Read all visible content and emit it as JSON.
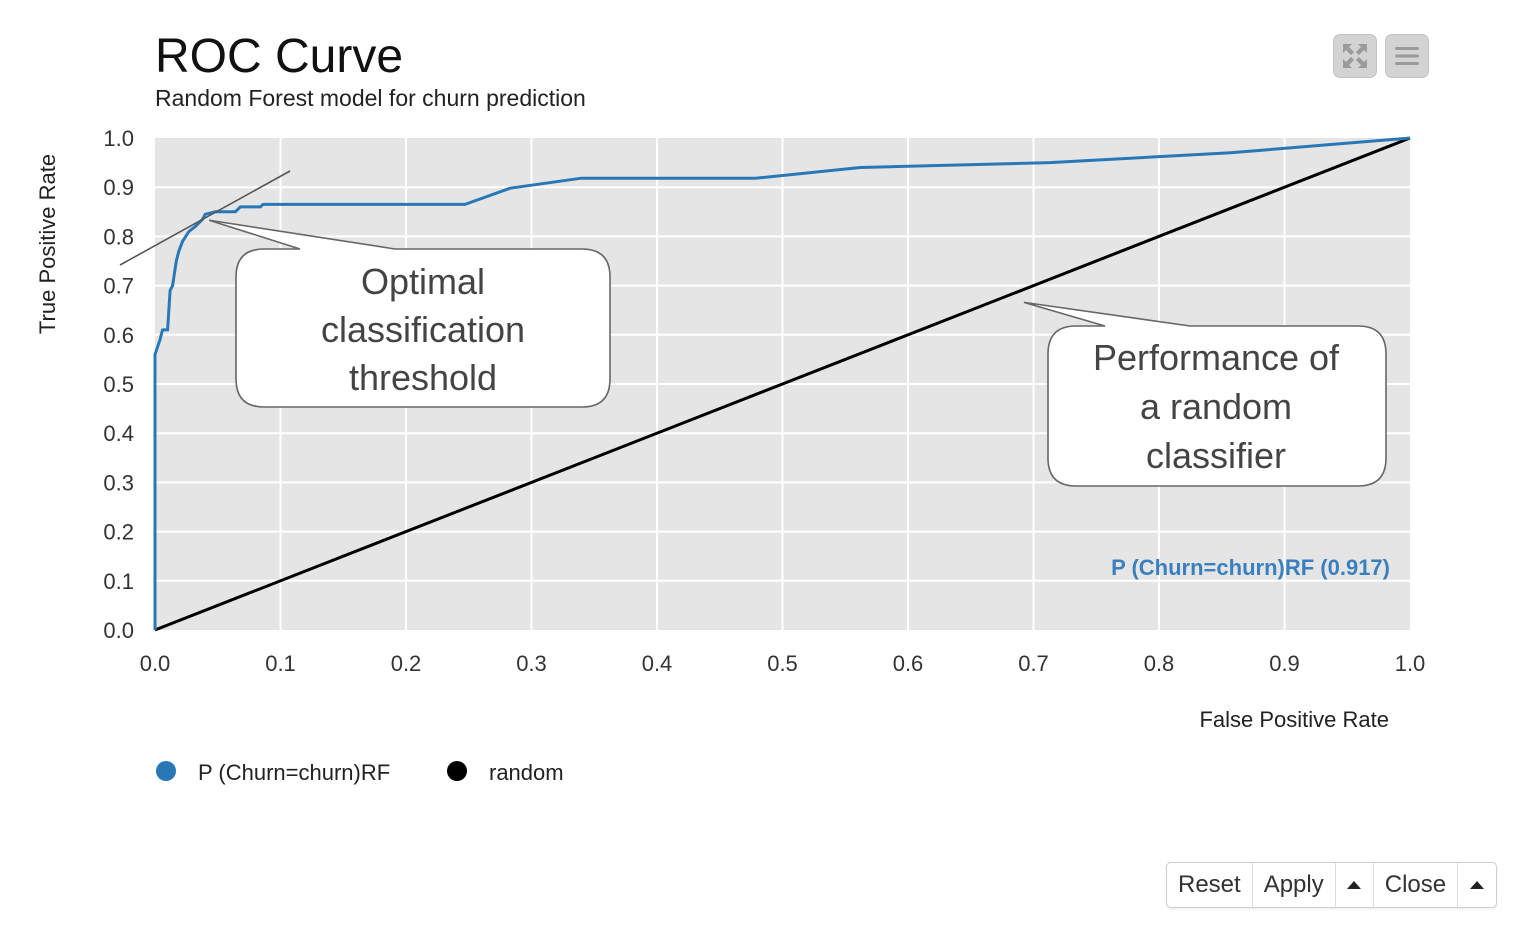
{
  "toolbar": {
    "fullscreen_icon": "fullscreen-icon",
    "menu_icon": "hamburger-menu-icon"
  },
  "buttons": {
    "reset": "Reset",
    "apply": "Apply",
    "apply_menu_icon": "caret-up-icon",
    "close": "Close",
    "close_menu_icon": "caret-up-icon"
  },
  "chart_data": {
    "type": "line",
    "title": "ROC Curve",
    "subtitle": "Random Forest model for churn prediction",
    "xlabel": "False Positive Rate",
    "ylabel": "True Positive Rate",
    "xlim": [
      0,
      1
    ],
    "ylim": [
      0,
      1
    ],
    "xticks": [
      "0.0",
      "0.1",
      "0.2",
      "0.3",
      "0.4",
      "0.5",
      "0.6",
      "0.7",
      "0.8",
      "0.9",
      "1.0"
    ],
    "yticks": [
      "0.0",
      "0.1",
      "0.2",
      "0.3",
      "0.4",
      "0.5",
      "0.6",
      "0.7",
      "0.8",
      "0.9",
      "1.0"
    ],
    "grid": true,
    "legend_position": "bottom-left",
    "series": [
      {
        "name": "P (Churn=churn)RF",
        "color": "#2878b8",
        "auc_label": "P (Churn=churn)RF (0.917)",
        "auc": 0.917,
        "x": [
          0.0,
          0.0,
          0.004,
          0.006,
          0.01,
          0.012,
          0.014,
          0.017,
          0.019,
          0.022,
          0.027,
          0.032,
          0.038,
          0.04,
          0.048,
          0.064,
          0.068,
          0.084,
          0.086,
          0.247,
          0.283,
          0.339,
          0.478,
          0.562,
          0.713,
          0.857,
          1.0
        ],
        "y": [
          0.0,
          0.56,
          0.59,
          0.61,
          0.61,
          0.69,
          0.7,
          0.75,
          0.77,
          0.79,
          0.81,
          0.82,
          0.835,
          0.845,
          0.85,
          0.85,
          0.86,
          0.86,
          0.865,
          0.865,
          0.898,
          0.918,
          0.918,
          0.94,
          0.95,
          0.97,
          1.0
        ]
      },
      {
        "name": "random",
        "color": "#000000",
        "x": [
          0.0,
          1.0
        ],
        "y": [
          0.0,
          1.0
        ]
      }
    ],
    "annotations": [
      {
        "lines": [
          "Optimal",
          "classification",
          "threshold"
        ],
        "point": [
          0.04,
          0.845
        ],
        "has_tangent_line": true
      },
      {
        "lines": [
          "Performance of",
          "a random",
          "classifier"
        ],
        "point": [
          0.69,
          0.67
        ]
      }
    ]
  }
}
